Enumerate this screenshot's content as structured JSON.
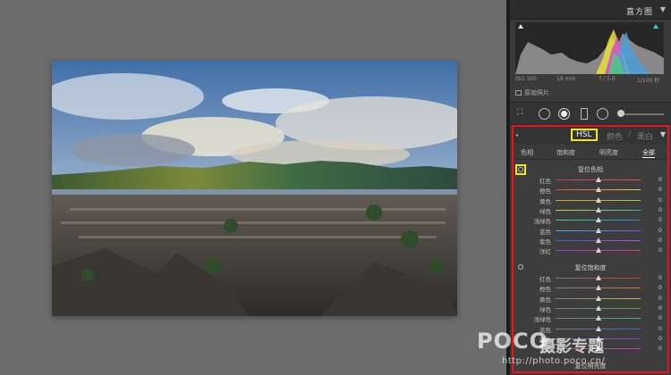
{
  "histogram": {
    "title": "直方图",
    "iso": "ISO 100",
    "focal": "18 mm",
    "aperture": "f / 5.0",
    "shutter": "1/100 秒",
    "original_label": "原始照片"
  },
  "hsl": {
    "tabs": {
      "hsl": "HSL",
      "color": "颜色",
      "bw": "黑白",
      "sep": "/"
    },
    "subtabs": {
      "hue": "色相",
      "saturation": "饱和度",
      "luminance": "明亮度",
      "all": "全部"
    },
    "groups": [
      {
        "title": "复位色相",
        "rows": [
          {
            "label": "红色",
            "value": "0"
          },
          {
            "label": "橙色",
            "value": "0"
          },
          {
            "label": "黄色",
            "value": "0"
          },
          {
            "label": "绿色",
            "value": "0"
          },
          {
            "label": "浅绿色",
            "value": "0"
          },
          {
            "label": "蓝色",
            "value": "0"
          },
          {
            "label": "紫色",
            "value": "0"
          },
          {
            "label": "洋红",
            "value": "0"
          }
        ]
      },
      {
        "title": "复位饱和度",
        "rows": [
          {
            "label": "红色",
            "value": "0"
          },
          {
            "label": "橙色",
            "value": "0"
          },
          {
            "label": "黄色",
            "value": "0"
          },
          {
            "label": "绿色",
            "value": "0"
          },
          {
            "label": "浅绿色",
            "value": "0"
          },
          {
            "label": "蓝色",
            "value": "0"
          },
          {
            "label": "紫色",
            "value": "0"
          },
          {
            "label": "洋红",
            "value": "0"
          }
        ]
      },
      {
        "title": "复位明亮度",
        "rows": []
      }
    ]
  },
  "watermark": {
    "brand": "POCO",
    "sub": "摄影专题",
    "url": "http://photo.poco.cn/"
  },
  "colors": {
    "accent_red": "#e4161c",
    "highlight_yellow": "#f0e52a"
  }
}
